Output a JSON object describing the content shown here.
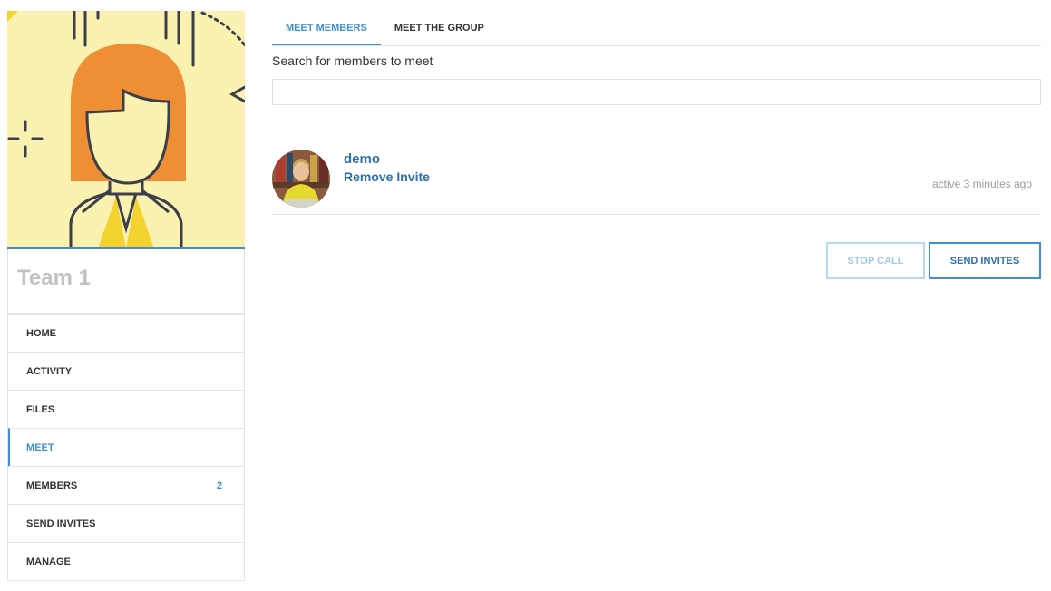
{
  "sidebar": {
    "team_name": "Team 1",
    "nav": [
      {
        "label": "HOME"
      },
      {
        "label": "ACTIVITY"
      },
      {
        "label": "FILES"
      },
      {
        "label": "MEET",
        "active": true
      },
      {
        "label": "MEMBERS",
        "count": "2"
      },
      {
        "label": "SEND INVITES"
      },
      {
        "label": "MANAGE"
      }
    ]
  },
  "tabs": [
    {
      "label": "MEET MEMBERS",
      "active": true
    },
    {
      "label": "MEET THE GROUP"
    }
  ],
  "search": {
    "label": "Search for members to meet",
    "value": "",
    "placeholder": ""
  },
  "members": [
    {
      "name": "demo",
      "action": "Remove Invite",
      "activity": "active 3 minutes ago"
    }
  ],
  "actions": {
    "stop_call": "STOP CALL",
    "send_invites": "SEND INVITES"
  },
  "colors": {
    "accent": "#3d8fd6",
    "link": "#2f6fb0",
    "cover_bg": "#fbf1b0",
    "cover_figure": "#ee8f35"
  }
}
